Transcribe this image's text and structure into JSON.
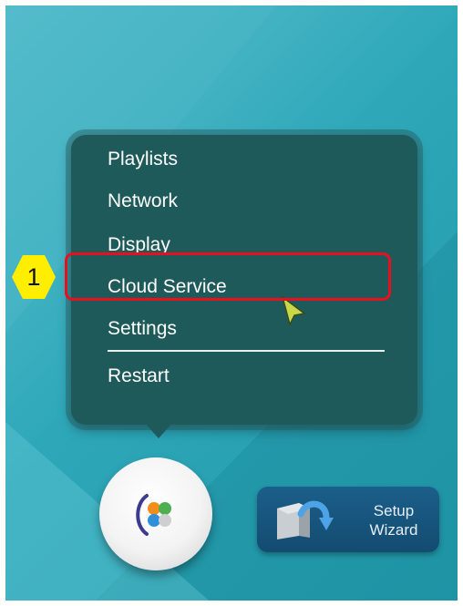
{
  "menu": {
    "items": [
      {
        "label": "Playlists"
      },
      {
        "label": "Network"
      },
      {
        "label": "Display"
      },
      {
        "label": "Cloud Service"
      },
      {
        "label": "Settings"
      },
      {
        "label": "Restart"
      }
    ]
  },
  "annotation": {
    "step_number": "1",
    "highlight_color": "#e8101e",
    "badge_color": "#ffee00"
  },
  "wizard": {
    "label_line1": "Setup",
    "label_line2": "Wizard"
  },
  "icons": {
    "home": "home-logo-icon",
    "wizard": "setup-wizard-icon",
    "cursor": "mouse-pointer-icon"
  },
  "colors": {
    "menu_background": "#1f5a5b",
    "screen_background": "#2aa3b6",
    "wizard_button": "#134b71"
  }
}
